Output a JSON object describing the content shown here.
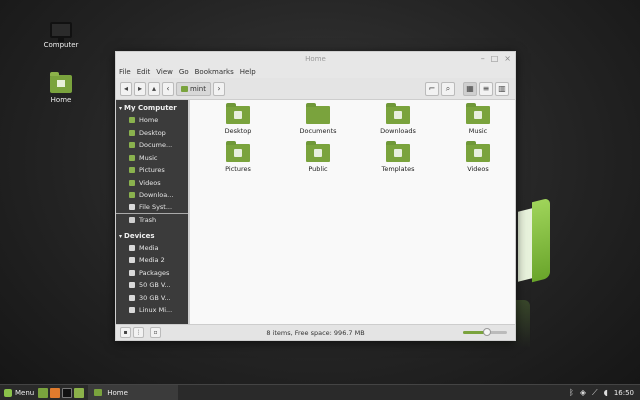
{
  "desktop": {
    "icons": [
      {
        "label": "Computer"
      },
      {
        "label": "Home"
      }
    ]
  },
  "window": {
    "title": "Home",
    "controls": {
      "minimize": "–",
      "maximize": "□",
      "close": "×"
    },
    "menu": [
      "File",
      "Edit",
      "View",
      "Go",
      "Bookmarks",
      "Help"
    ],
    "toolbar": {
      "back": "◂",
      "forward": "▸",
      "up": "▴",
      "prev_crumb": "‹",
      "location": "mint",
      "next_crumb": "›",
      "toggle_location": "⌐",
      "search": "⌕",
      "view_icons": "▦",
      "view_list": "≡",
      "view_compact": "▥"
    },
    "sidebar": {
      "sections": [
        {
          "title": "My Computer",
          "items": [
            {
              "label": "Home",
              "icon": "home-folder-icon"
            },
            {
              "label": "Desktop",
              "icon": "desktop-folder-icon"
            },
            {
              "label": "Docume...",
              "icon": "documents-folder-icon"
            },
            {
              "label": "Music",
              "icon": "music-folder-icon"
            },
            {
              "label": "Pictures",
              "icon": "pictures-folder-icon"
            },
            {
              "label": "Videos",
              "icon": "videos-folder-icon"
            },
            {
              "label": "Downloa...",
              "icon": "downloads-folder-icon"
            },
            {
              "label": "File Syst...",
              "icon": "filesystem-icon"
            },
            {
              "label": "Trash",
              "icon": "trash-icon"
            }
          ]
        },
        {
          "title": "Devices",
          "items": [
            {
              "label": "Media",
              "icon": "drive-icon"
            },
            {
              "label": "Media 2",
              "icon": "drive-icon"
            },
            {
              "label": "Packages",
              "icon": "drive-icon"
            },
            {
              "label": "50 GB V...",
              "icon": "drive-icon"
            },
            {
              "label": "30 GB V...",
              "icon": "drive-icon"
            },
            {
              "label": "Linux Mi...",
              "icon": "drive-icon"
            }
          ]
        }
      ]
    },
    "files": [
      {
        "label": "Desktop",
        "icon": "desktop-folder-icon"
      },
      {
        "label": "Documents",
        "icon": "documents-folder-icon"
      },
      {
        "label": "Downloads",
        "icon": "downloads-folder-icon"
      },
      {
        "label": "Music",
        "icon": "music-folder-icon"
      },
      {
        "label": "Pictures",
        "icon": "pictures-folder-icon"
      },
      {
        "label": "Public",
        "icon": "public-folder-icon"
      },
      {
        "label": "Templates",
        "icon": "templates-folder-icon"
      },
      {
        "label": "Videos",
        "icon": "videos-folder-icon"
      }
    ],
    "status": {
      "text": "8 items, Free space: 996.7 MB",
      "zoom_fraction": 0.55
    }
  },
  "taskbar": {
    "menu_label": "Menu",
    "task_label": "Home",
    "clock": "16:50"
  },
  "colors": {
    "accent": "#7aa33d",
    "sidebar_bg": "#3b3b3b",
    "taskbar_bg": "#2a2a2a"
  }
}
